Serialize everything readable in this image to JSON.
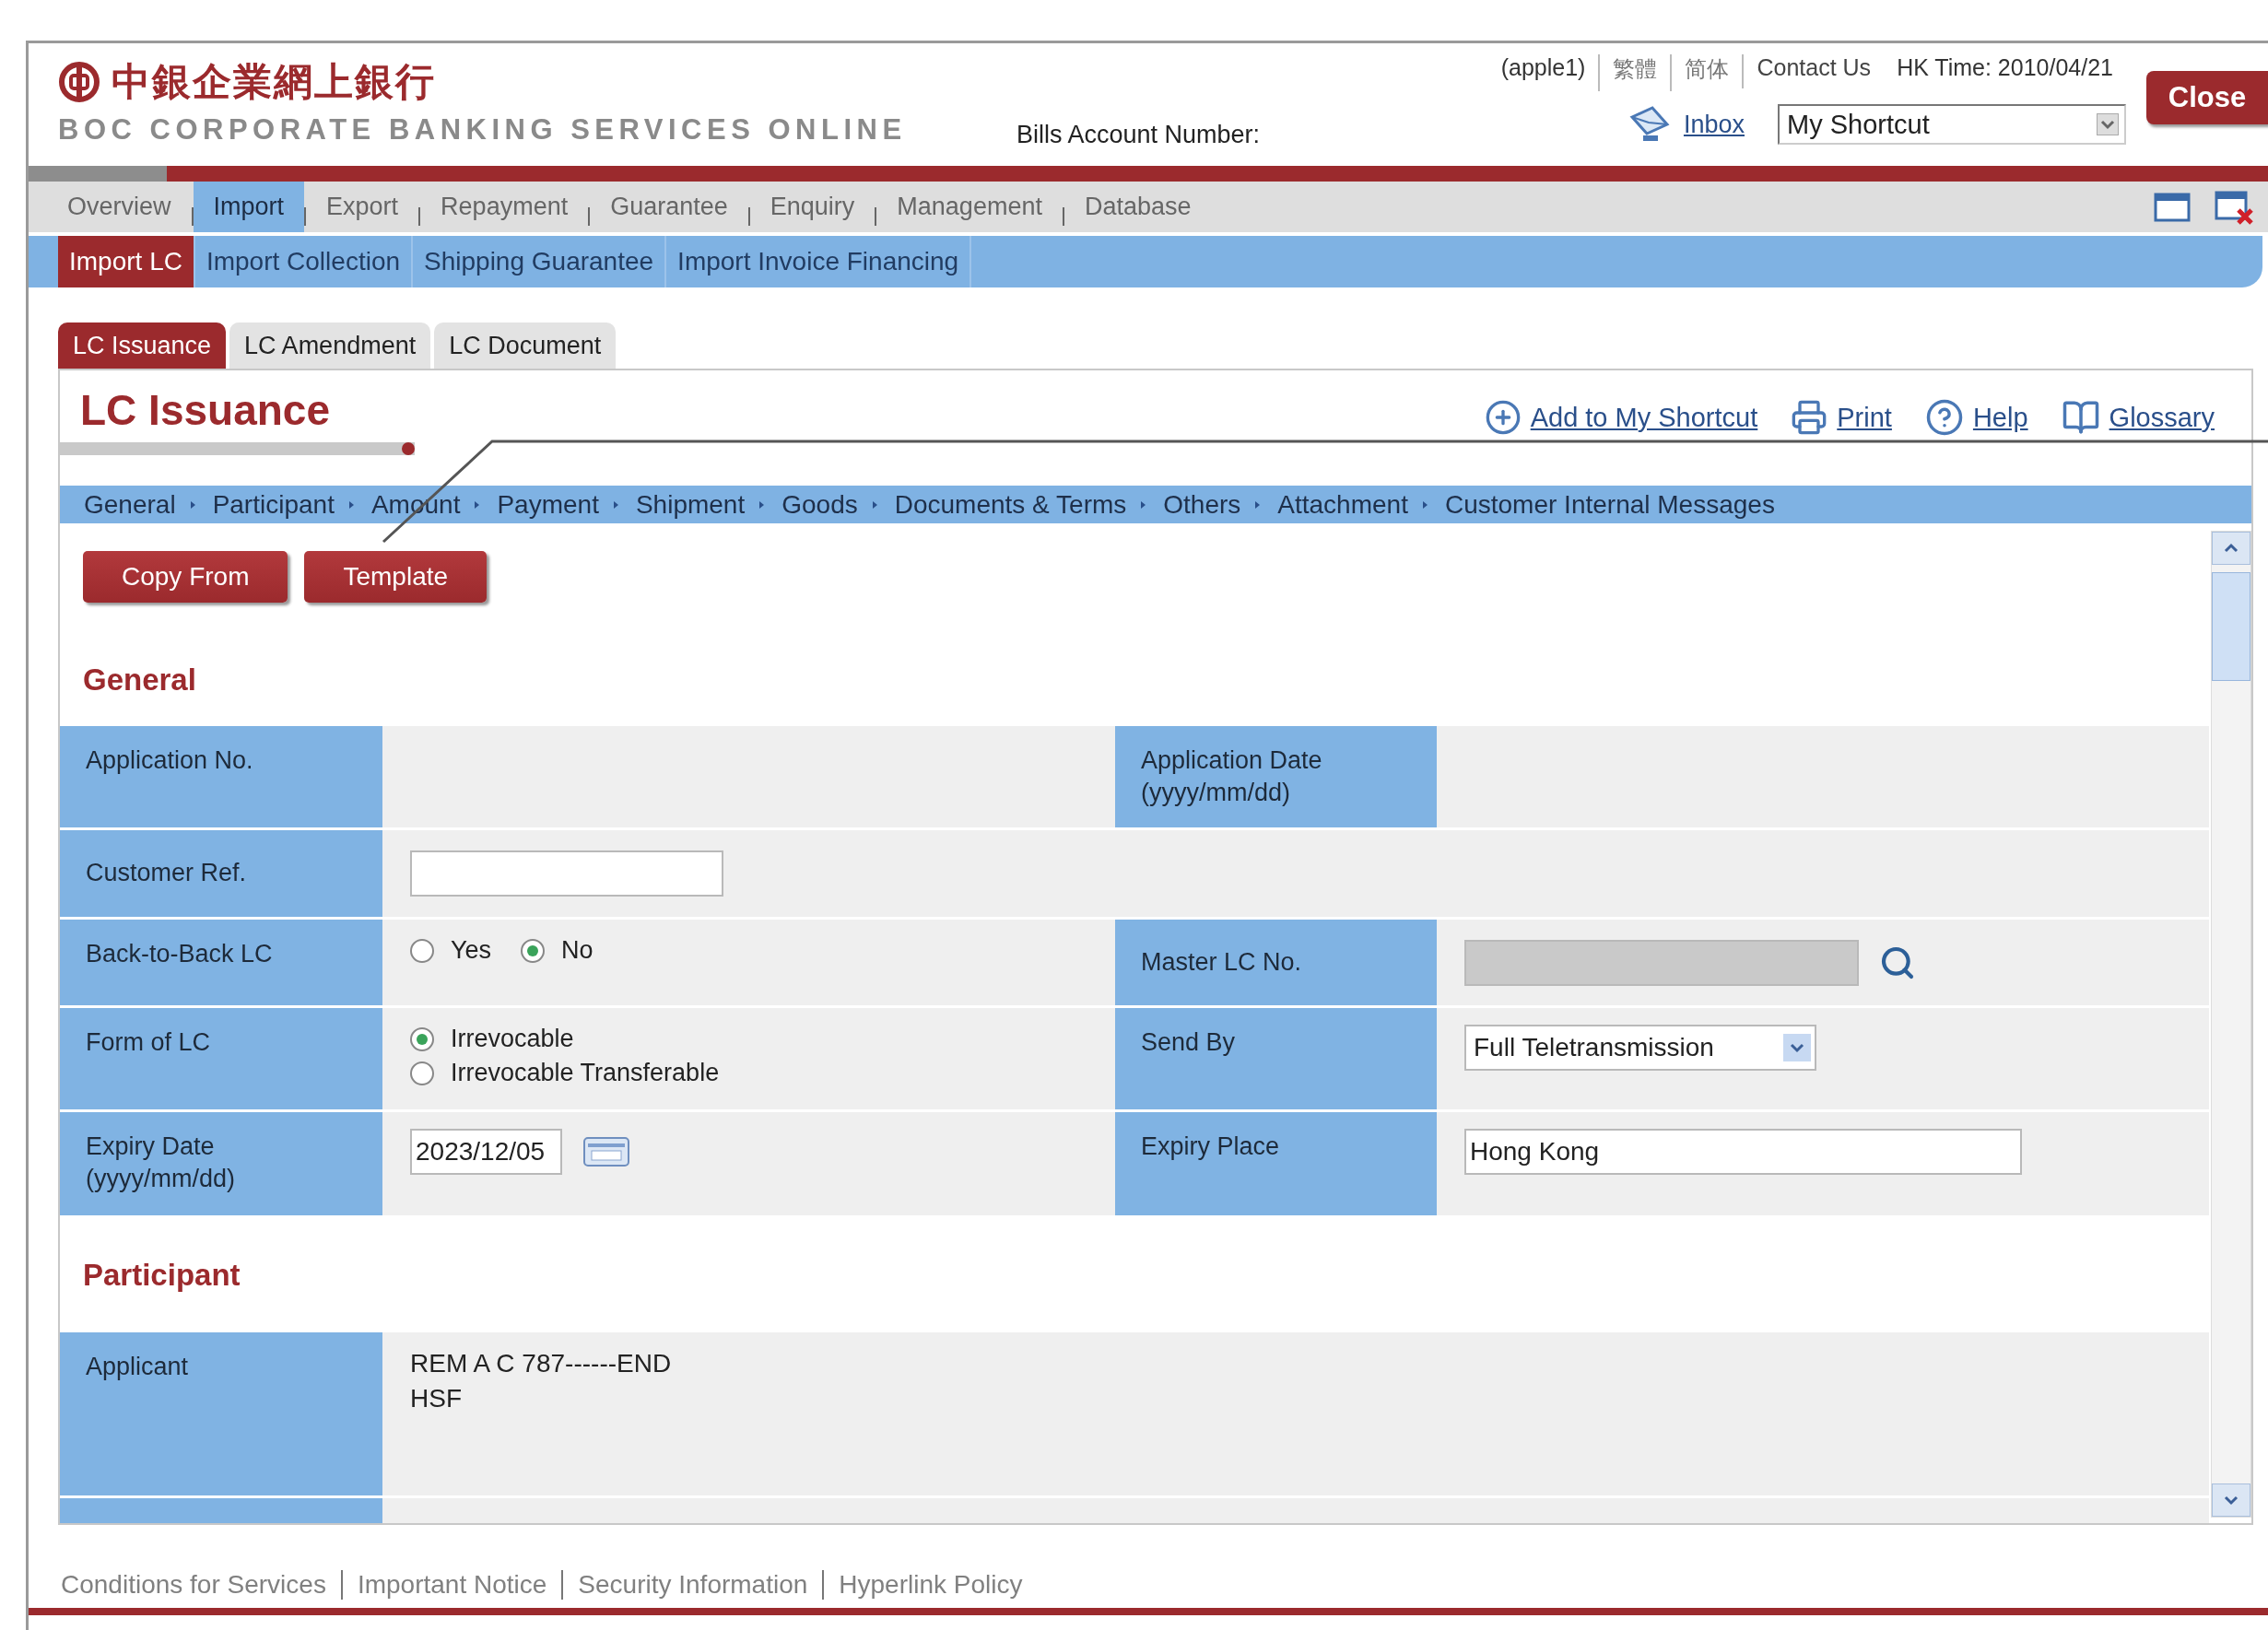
{
  "header": {
    "logo_chinese": "中銀企業網上銀行",
    "logo_english": "BOC CORPORATE BANKING SERVICES ONLINE",
    "bills_account_label": "Bills Account Number:",
    "user": "(apple1)",
    "language_links": [
      "繁體",
      "简体"
    ],
    "contact_link": "Contact Us",
    "hk_time": "HK Time: 2010/04/21",
    "inbox_link": "Inbox",
    "shortcut_select": "My Shortcut",
    "close_button": "Close"
  },
  "main_nav": [
    {
      "label": "Overview",
      "selected": false
    },
    {
      "label": "Import",
      "selected": true
    },
    {
      "label": "Export",
      "selected": false
    },
    {
      "label": "Repayment",
      "selected": false
    },
    {
      "label": "Guarantee",
      "selected": false
    },
    {
      "label": "Enquiry",
      "selected": false
    },
    {
      "label": "Management",
      "selected": false
    },
    {
      "label": "Database",
      "selected": false
    }
  ],
  "sub_nav": [
    {
      "label": "Import LC",
      "selected": true
    },
    {
      "label": "Import Collection",
      "selected": false
    },
    {
      "label": "Shipping Guarantee",
      "selected": false
    },
    {
      "label": "Import Invoice Financing",
      "selected": false
    }
  ],
  "page_tabs": [
    {
      "label": "LC Issuance",
      "selected": true
    },
    {
      "label": "LC Amendment",
      "selected": false
    },
    {
      "label": "LC Document",
      "selected": false
    }
  ],
  "page_title": "LC Issuance",
  "page_actions": [
    {
      "label": "Add to My Shortcut",
      "kind": "add"
    },
    {
      "label": "Print",
      "kind": "print"
    },
    {
      "label": "Help",
      "kind": "help"
    },
    {
      "label": "Glossary",
      "kind": "glossary"
    }
  ],
  "steps": [
    "General",
    "Participant",
    "Amount",
    "Payment",
    "Shipment",
    "Goods",
    "Documents & Terms",
    "Others",
    "Attachment",
    "Customer Internal Messages"
  ],
  "buttons": [
    "Copy From",
    "Template"
  ],
  "sections": [
    {
      "title": "General",
      "rows": [
        [
          {
            "label": "Application No."
          },
          {
            "label": "Application Date\n(yyyy/mm/dd)"
          }
        ],
        [
          {
            "label": "Customer Ref.",
            "control": {
              "kind": "input"
            }
          }
        ],
        [
          {
            "label": "Back-to-Back LC",
            "control": {
              "kind": "radio_row",
              "options": [
                {
                  "label": "Yes",
                  "selected": false
                },
                {
                  "label": "No",
                  "selected": true
                }
              ]
            }
          },
          {
            "label": "Master LC No.",
            "control": {
              "kind": "lookup",
              "disabled": true
            }
          }
        ],
        [
          {
            "label": "Form of LC",
            "control": {
              "kind": "radio_list",
              "options": [
                {
                  "label": "Irrevocable",
                  "selected": true
                },
                {
                  "label": "Irrevocable Transferable",
                  "selected": false
                }
              ]
            }
          },
          {
            "label": "Send By",
            "control": {
              "kind": "select",
              "value": "Full Teletransmission"
            }
          }
        ],
        [
          {
            "label": "Expiry Date\n(yyyy/mm/dd)",
            "control": {
              "kind": "date",
              "value": "2023/12/05"
            }
          },
          {
            "label": "Expiry Place",
            "control": {
              "kind": "input",
              "value": "Hong Kong"
            }
          }
        ]
      ]
    },
    {
      "title": "Participant",
      "rows": [
        [
          {
            "label": "Applicant",
            "control": {
              "kind": "text_lines",
              "lines": [
                "REM A C 787------END",
                "HSF"
              ]
            }
          }
        ]
      ]
    }
  ],
  "footer_links": [
    "Conditions for Services",
    "Important Notice",
    "Security Information",
    "Hyperlink Policy"
  ]
}
